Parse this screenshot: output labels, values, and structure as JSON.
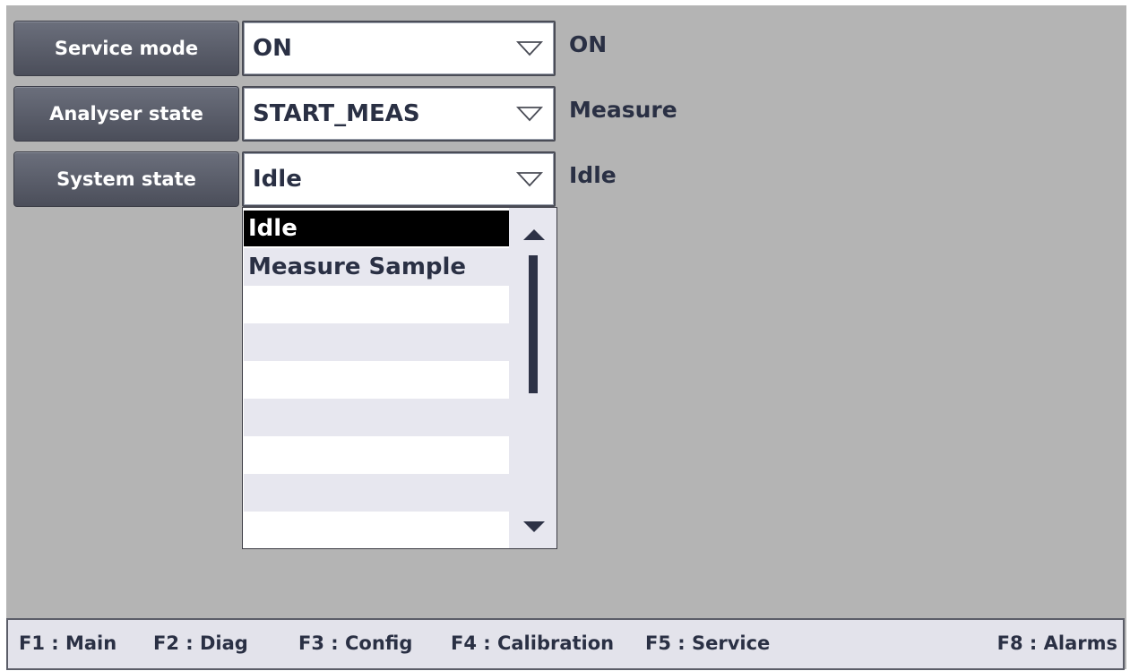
{
  "rows": [
    {
      "label": "Service mode",
      "value": "ON",
      "status": "ON"
    },
    {
      "label": "Analyser state",
      "value": "START_MEAS",
      "status": "Measure"
    },
    {
      "label": "System state",
      "value": "Idle",
      "status": "Idle"
    }
  ],
  "dropdown": {
    "items": [
      "Idle",
      "Measure Sample",
      "",
      "",
      "",
      "",
      "",
      ""
    ],
    "selected": "Idle"
  },
  "function_keys": [
    "F1 : Main",
    "F2 : Diag",
    "F3 : Config",
    "F4 : Calibration",
    "F5 : Service",
    "F8 : Alarms"
  ],
  "icons": {
    "combo_arrow": "triangle-down-outline-icon",
    "scroll_up": "triangle-up-icon",
    "scroll_down": "triangle-down-icon"
  },
  "colors": {
    "background": "#b4b4b4",
    "button": "#5a5e6a",
    "text": "#2a3044",
    "selected_item": "#000000",
    "function_bar": "#e3e3eb"
  }
}
